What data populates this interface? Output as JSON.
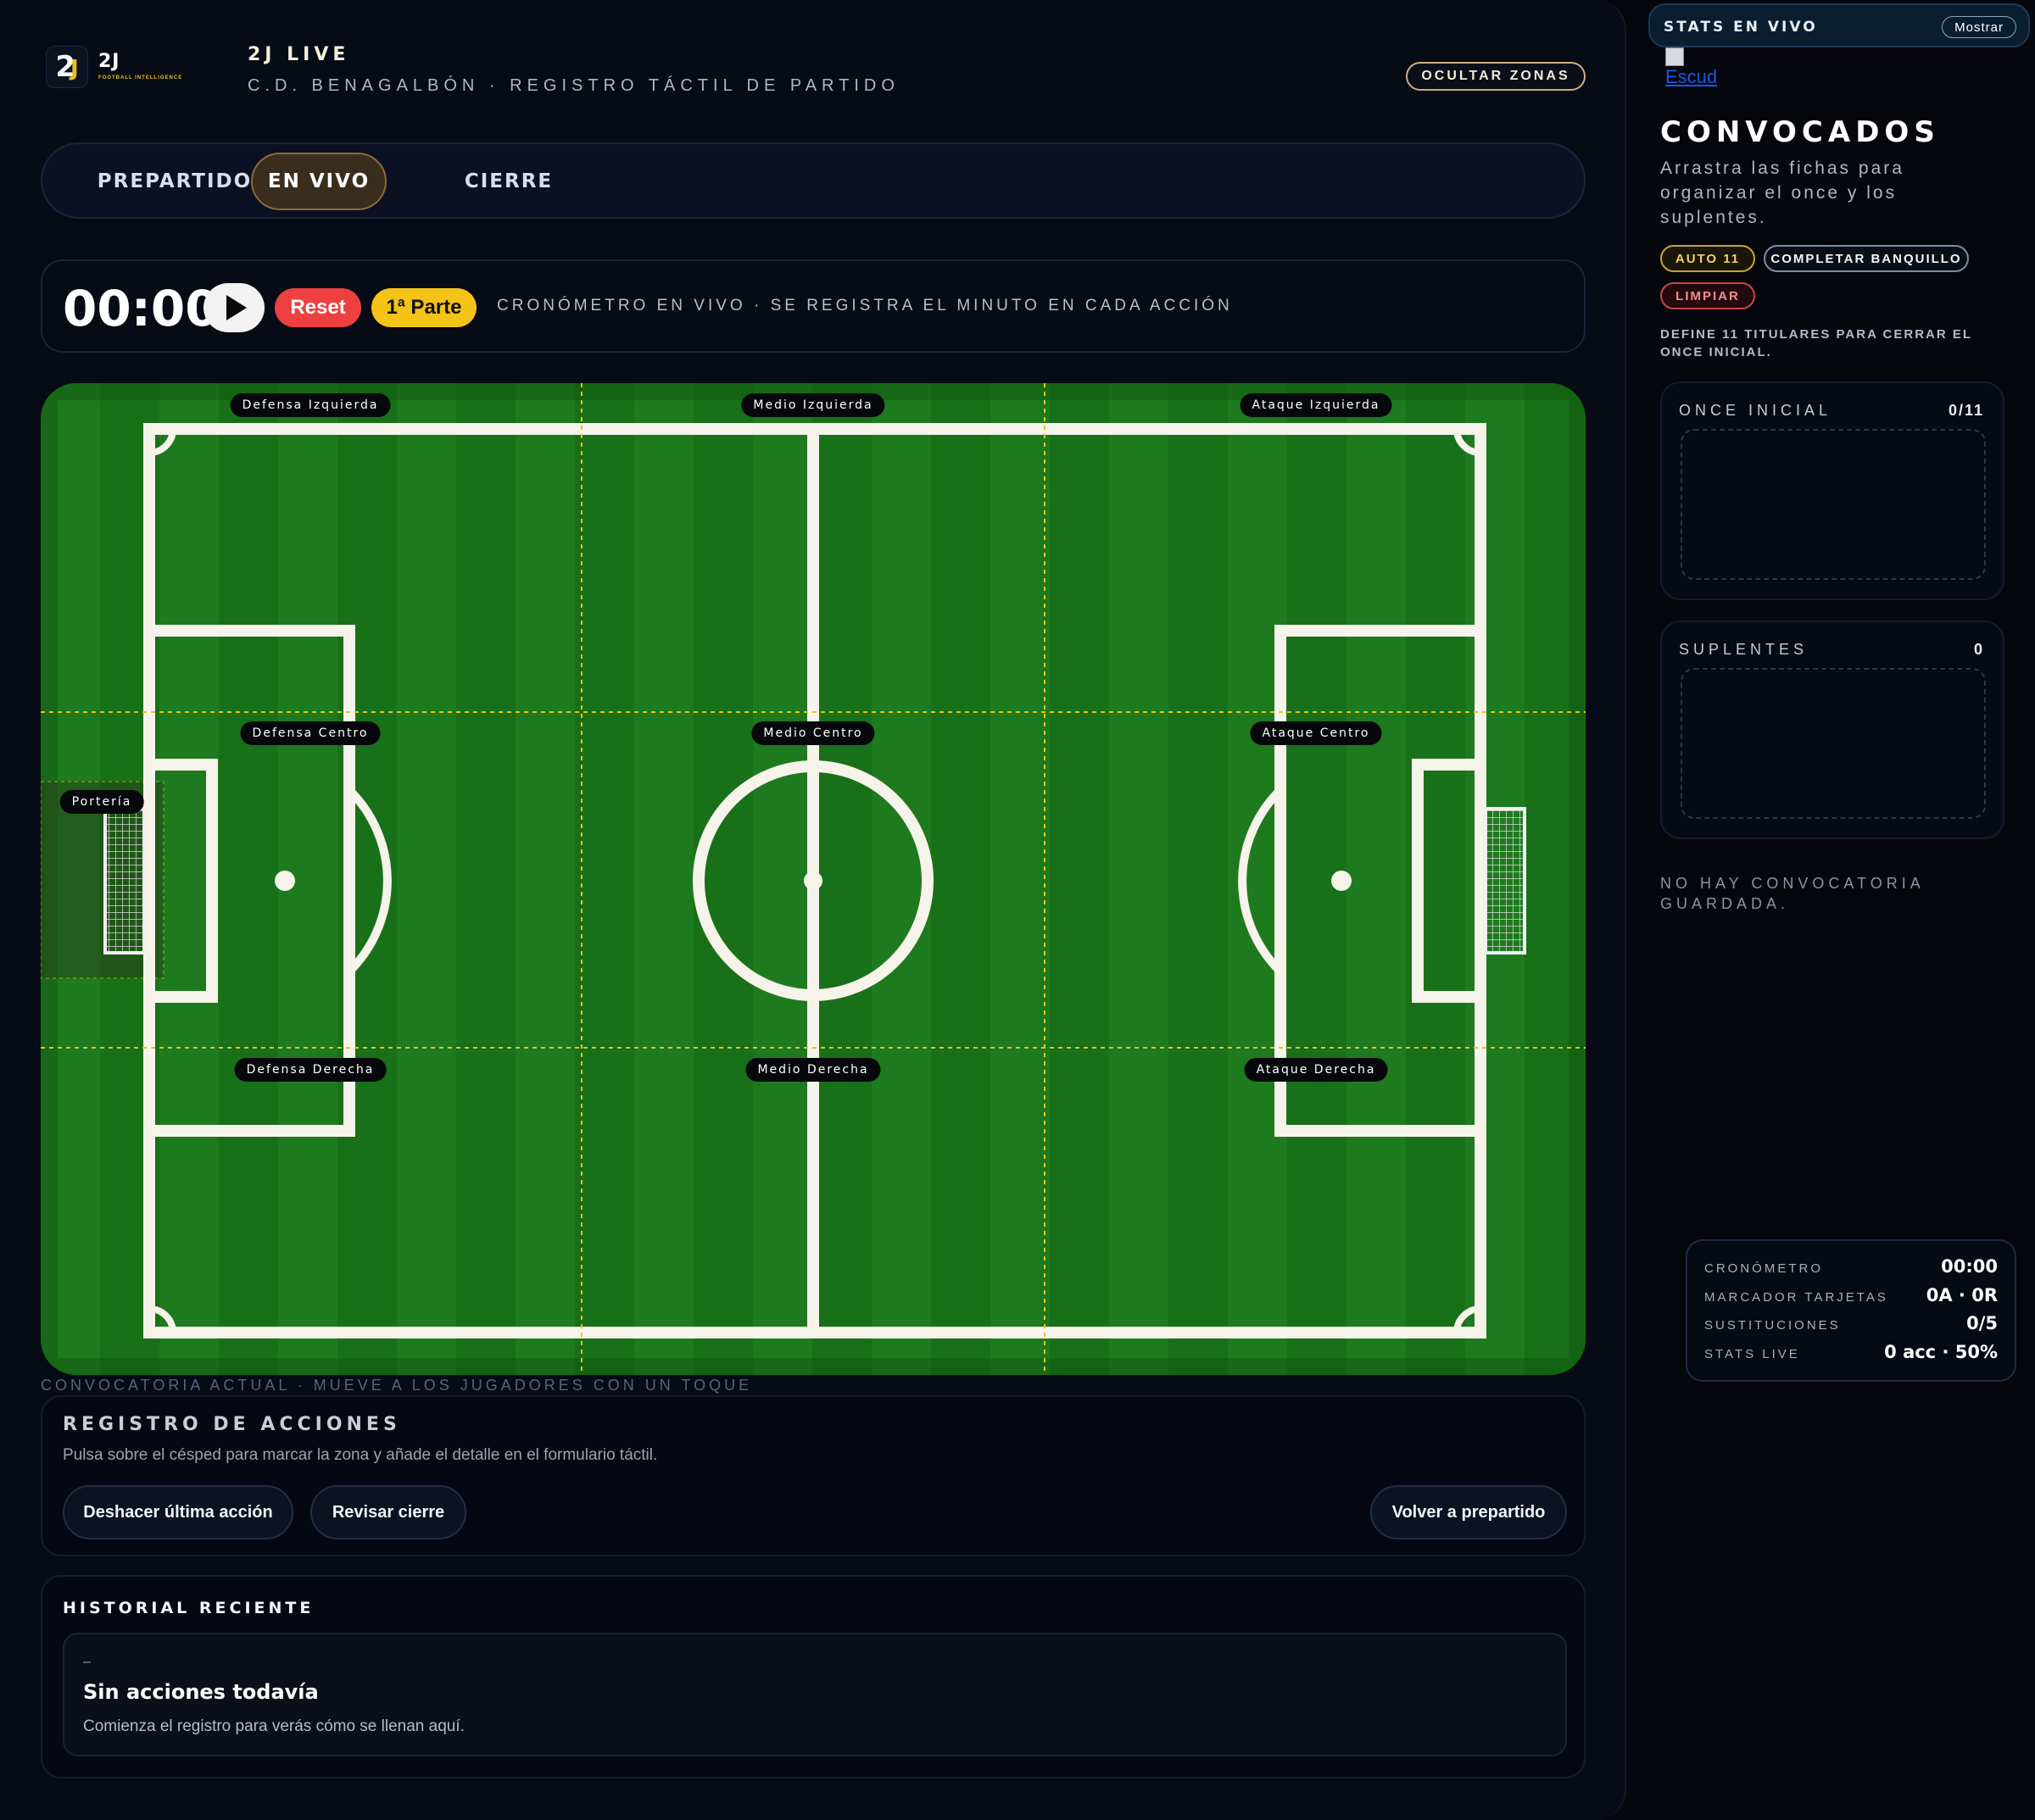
{
  "header": {
    "logo_main": "2J",
    "logo_tagline": "FOOTBALL INTELLIGENCE",
    "title": "2J LIVE",
    "subtitle": "C.D. BENAGALBÓN · REGISTRO TÁCTIL DE PARTIDO",
    "toggle_zones_label": "OCULTAR ZONAS"
  },
  "tabs": [
    {
      "label": "PREPARTIDO",
      "active": false
    },
    {
      "label": "EN VIVO",
      "active": true
    },
    {
      "label": "CIERRE",
      "active": false
    }
  ],
  "timer": {
    "clock": "00:00",
    "reset_label": "Reset",
    "half_label": "1ª Parte",
    "note": "CRONÓMETRO EN VIVO · SE REGISTRA EL MINUTO EN CADA ACCIÓN"
  },
  "pitch": {
    "zones": {
      "def_left": "Defensa Izquierda",
      "mid_left": "Medio Izquierda",
      "att_left": "Ataque Izquierda",
      "def_center": "Defensa Centro",
      "mid_center": "Medio Centro",
      "att_center": "Ataque Centro",
      "def_right": "Defensa Derecha",
      "mid_right": "Medio Derecha",
      "att_right": "Ataque Derecha",
      "goal": "Portería"
    },
    "colors": {
      "grass_a": "#1e7a1e",
      "grass_b": "#187018",
      "zone_line": "#e3c51c",
      "lines": "#ffffff"
    }
  },
  "caption": "CONVOCATORIA ACTUAL · MUEVE A LOS JUGADORES CON UN TOQUE",
  "actions": {
    "title": "REGISTRO DE ACCIONES",
    "description": "Pulsa sobre el césped para marcar la zona y añade el detalle en el formulario táctil.",
    "undo_label": "Deshacer última acción",
    "review_label": "Revisar cierre",
    "back_label": "Volver a prepartido"
  },
  "history": {
    "title": "HISTORIAL RECIENTE",
    "dash": "–",
    "empty_title": "Sin acciones todavía",
    "empty_text": "Comienza el registro para verás cómo se llenan aquí."
  },
  "sidebar": {
    "stats_title": "STATS EN VIVO",
    "show_label": "Mostrar",
    "crest_alt": "Escud",
    "squad_title": "CONVOCADOS",
    "squad_desc": "Arrastra las fichas para organizar el once y los suplentes.",
    "auto_label": "AUTO 11",
    "complete_label": "COMPLETAR BANQUILLO",
    "clear_label": "LIMPIAR",
    "define_note": "DEFINE 11 TITULARES PARA CERRAR EL ONCE INICIAL.",
    "lineup_label": "ONCE INICIAL",
    "lineup_count": "0/11",
    "bench_label": "SUPLENTES",
    "bench_count": "0",
    "no_squad": "NO HAY CONVOCATORIA GUARDADA."
  },
  "stats_card": [
    {
      "key": "CRONÓMETRO",
      "value": "00:00"
    },
    {
      "key": "MARCADOR TARJETAS",
      "value": "0A · 0R"
    },
    {
      "key": "SUSTITUCIONES",
      "value": "0/5"
    },
    {
      "key": "STATS LIVE",
      "value": "0 acc · 50%"
    }
  ]
}
